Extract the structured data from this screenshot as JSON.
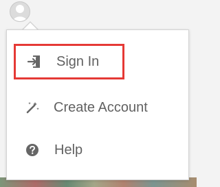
{
  "menu": {
    "items": [
      {
        "label": "Sign In",
        "icon": "sign-in-icon"
      },
      {
        "label": "Create Account",
        "icon": "magic-wand-icon"
      },
      {
        "label": "Help",
        "icon": "help-icon"
      }
    ]
  },
  "colors": {
    "highlight_border": "#e53935",
    "menu_text": "#616161",
    "icon": "#666666"
  }
}
